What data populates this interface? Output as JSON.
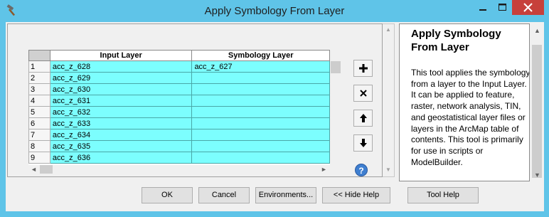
{
  "window": {
    "title": "Apply Symbology From Layer",
    "titlebar_color": "#5fc4e8",
    "close_color": "#c7403b"
  },
  "grid": {
    "columns": [
      "Input Layer",
      "Symbology Layer"
    ],
    "rows": [
      {
        "num": "1",
        "input": "acc_z_628",
        "symbology": "acc_z_627"
      },
      {
        "num": "2",
        "input": "acc_z_629",
        "symbology": ""
      },
      {
        "num": "3",
        "input": "acc_z_630",
        "symbology": ""
      },
      {
        "num": "4",
        "input": "acc_z_631",
        "symbology": ""
      },
      {
        "num": "5",
        "input": "acc_z_632",
        "symbology": ""
      },
      {
        "num": "6",
        "input": "acc_z_633",
        "symbology": ""
      },
      {
        "num": "7",
        "input": "acc_z_634",
        "symbology": ""
      },
      {
        "num": "8",
        "input": "acc_z_635",
        "symbology": ""
      },
      {
        "num": "9",
        "input": "acc_z_636",
        "symbology": ""
      }
    ],
    "cell_color": "#7cfefe"
  },
  "side_tools": {
    "add_icon": "plus-icon",
    "remove_icon": "x-icon",
    "up_icon": "arrow-up-icon",
    "down_icon": "arrow-down-icon",
    "help_icon_glyph": "?"
  },
  "help": {
    "title": "Apply Symbology From Layer",
    "body": "This tool applies the symbology from a layer to the Input Layer. It can be applied to feature, raster, network analysis, TIN, and geostatistical layer files or layers in the ArcMap table of contents. This tool is primarily for use in scripts or ModelBuilder."
  },
  "buttons": {
    "ok": "OK",
    "cancel": "Cancel",
    "environments": "Environments...",
    "hide_help": "<< Hide Help",
    "tool_help": "Tool Help"
  }
}
